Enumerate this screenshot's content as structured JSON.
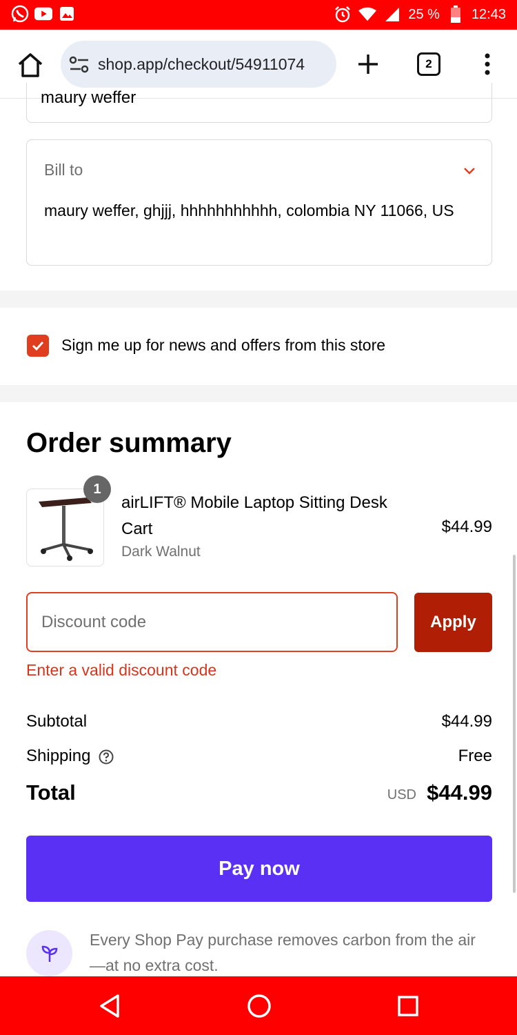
{
  "status_bar": {
    "battery": "25 %",
    "time": "12:43",
    "left_icons": [
      "whatsapp-icon",
      "youtube-icon",
      "gallery-icon"
    ],
    "right_icons": [
      "alarm-icon",
      "wifi-icon",
      "signal-icon",
      "battery-icon"
    ]
  },
  "browser": {
    "url": "shop.app/checkout/54911074",
    "tab_count": "2"
  },
  "ship_to": {
    "name_partial": "maury weffer"
  },
  "bill_to": {
    "label": "Bill to",
    "address": "maury weffer, ghjjj, hhhhhhhhhhh, colombia NY 11066, US"
  },
  "newsletter": {
    "label": "Sign me up for news and offers from this store",
    "checked": true
  },
  "order_summary": {
    "title": "Order summary",
    "product": {
      "quantity": "1",
      "name": "airLIFT® Mobile Laptop Sitting Desk Cart",
      "variant": "Dark Walnut",
      "price": "$44.99"
    },
    "discount": {
      "placeholder": "Discount code",
      "value": "",
      "apply_label": "Apply",
      "error": "Enter a valid discount code"
    },
    "subtotal_label": "Subtotal",
    "subtotal_value": "$44.99",
    "shipping_label": "Shipping",
    "shipping_value": "Free",
    "total_label": "Total",
    "total_currency": "USD",
    "total_value": "$44.99"
  },
  "pay_button": "Pay now",
  "eco_note": "Every Shop Pay purchase removes carbon from the air—at no extra cost.",
  "colors": {
    "accent_red": "#e03f1f",
    "apply_red": "#b01e06",
    "shop_pay_purple": "#5a31f4",
    "system_bar": "#ff0000"
  }
}
